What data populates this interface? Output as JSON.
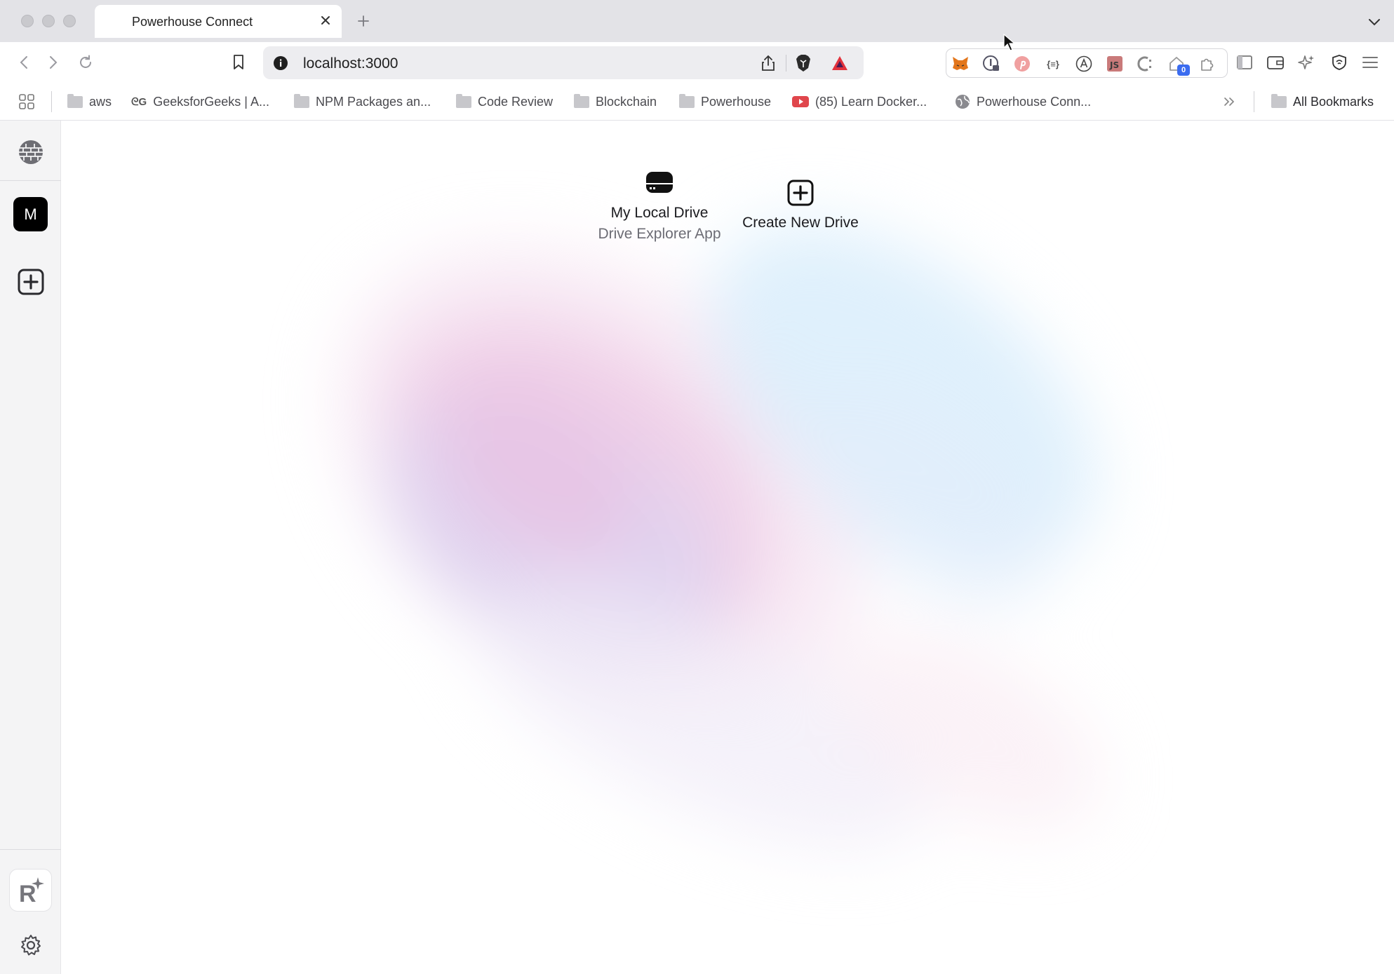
{
  "browser": {
    "tab_title": "Powerhouse Connect",
    "url": "localhost:3000",
    "extension_badge_count": "0",
    "bookmarks": [
      {
        "label": "aws",
        "icon": "folder-icon"
      },
      {
        "label": "GeeksforGeeks | A...",
        "icon": "gfg-icon"
      },
      {
        "label": "NPM Packages an...",
        "icon": "folder-icon"
      },
      {
        "label": "Code Review",
        "icon": "folder-icon"
      },
      {
        "label": "Blockchain",
        "icon": "folder-icon"
      },
      {
        "label": "Powerhouse",
        "icon": "folder-icon"
      },
      {
        "label": "(85) Learn Docker...",
        "icon": "youtube-icon"
      },
      {
        "label": "Powerhouse Conn...",
        "icon": "globe-icon"
      }
    ],
    "all_bookmarks_label": "All Bookmarks"
  },
  "sidebar": {
    "top_icon": "globe-grid-icon",
    "avatar_letter": "M",
    "add_icon": "plus-square-icon",
    "bottom_logo": "R",
    "settings_icon": "gear-icon"
  },
  "main": {
    "drives": [
      {
        "name": "My Local Drive",
        "subtitle": "Drive Explorer App",
        "icon": "hard-drive-icon"
      },
      {
        "name": "Create New Drive",
        "icon": "plus-square-icon"
      }
    ]
  },
  "colors": {
    "accent_pink": "#f0c6e3",
    "accent_blue": "#cfe6fb",
    "accent_purple": "#dcd3f0",
    "avatar_bg": "#000000",
    "badge_blue": "#3b6cf0"
  }
}
